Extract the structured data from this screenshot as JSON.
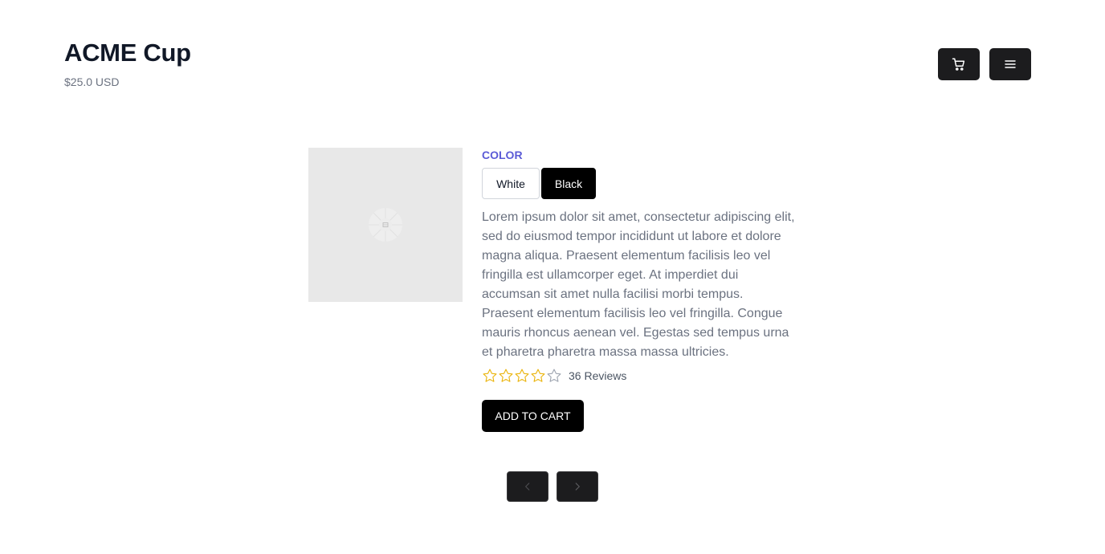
{
  "product": {
    "title": "ACME Cup",
    "price": "$25.0 USD",
    "color_label": "COLOR",
    "colors": [
      {
        "label": "White",
        "selected": false
      },
      {
        "label": "Black",
        "selected": true
      }
    ],
    "description": "Lorem ipsum dolor sit amet, consectetur adipiscing elit, sed do eiusmod tempor incididunt ut labore et dolore magna aliqua. Praesent elementum facilisis leo vel fringilla est ullamcorper eget. At imperdiet dui accumsan sit amet nulla facilisi morbi tempus. Praesent elementum facilisis leo vel fringilla. Congue mauris rhoncus aenean vel. Egestas sed tempus urna et pharetra pharetra massa massa ultricies.",
    "rating": 4,
    "rating_max": 5,
    "reviews": "36 Reviews",
    "add_to_cart": "ADD TO CART"
  },
  "icons": {
    "cart": "cart-icon",
    "menu": "menu-icon",
    "prev": "chevron-left-icon",
    "next": "chevron-right-icon",
    "image_placeholder": "image-placeholder-icon"
  },
  "colors": {
    "accent": "#5b5bd6",
    "star_filled": "#eab308",
    "star_empty": "#9ca3af",
    "button_dark": "#1c1c1e"
  }
}
